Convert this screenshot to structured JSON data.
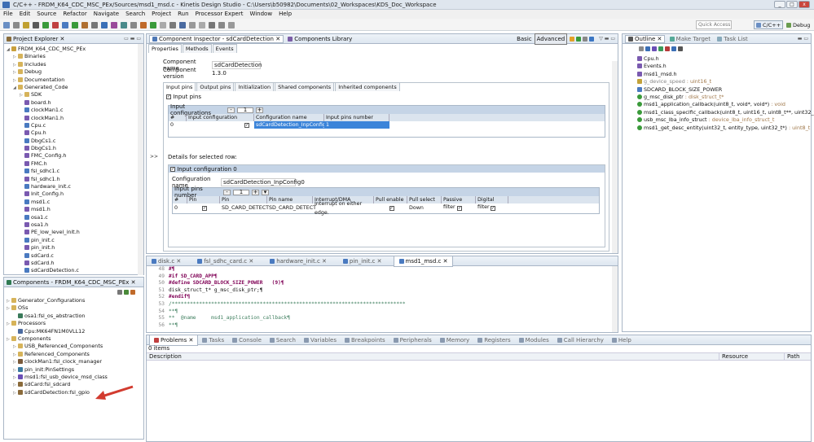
{
  "window": {
    "title": "C/C++ - FRDM_K64_CDC_MSC_PEx/Sources/msd1_msd.c - Kinetis Design Studio - C:\\Users\\b50982\\Documents\\02_Workspaces\\KDS_Doc_Workspace"
  },
  "menu": [
    "File",
    "Edit",
    "Source",
    "Refactor",
    "Navigate",
    "Search",
    "Project",
    "Run",
    "Processor Expert",
    "Window",
    "Help"
  ],
  "toolbar": {
    "quick_access": "Quick Access",
    "perspective_cpp": "C/C++",
    "perspective_debug": "Debug"
  },
  "project_explorer": {
    "tab": "Project Explorer",
    "items": [
      "FRDM_K64_CDC_MSC_PEx",
      "Binaries",
      "Includes",
      "Debug",
      "Documentation",
      "Generated_Code",
      "SDK",
      "board.h",
      "clockMan1.c",
      "clockMan1.h",
      "Cpu.c",
      "Cpu.h",
      "DbgCs1.c",
      "DbgCs1.h",
      "FMC_Config.h",
      "FMC.h",
      "fsl_sdhc1.c",
      "fsl_sdhc1.h",
      "hardware_init.c",
      "Init_Config.h",
      "msd1.c",
      "msd1.h",
      "osa1.c",
      "osa1.h",
      "PE_low_level_init.h",
      "pin_init.c",
      "pin_init.h",
      "sdCard.c",
      "sdCard.h",
      "sdCardDetection.c"
    ]
  },
  "components": {
    "tab": "Components - FRDM_K64_CDC_MSC_PEx",
    "items": [
      "Generator_Configurations",
      "OSs",
      "osa1:fsl_os_abstraction",
      "Processors",
      "Cpu:MK64FN1M0VLL12",
      "Components",
      "USB_Referenced_Components",
      "Referenced_Components",
      "clockMan1:fsl_clock_manager",
      "pin_init:PinSettings",
      "msd1:fsl_usb_device_msd_class",
      "sdCard:fsl_sdcard",
      "sdCardDetection:fsl_gpio"
    ]
  },
  "inspector": {
    "tab1": "Component Inspector - sdCardDetection",
    "tab2": "Components Library",
    "basic": "Basic",
    "advanced": "Advanced",
    "subtabs": [
      "Properties",
      "Methods",
      "Events"
    ],
    "component_name_label": "Component name",
    "component_name": "sdCardDetection",
    "component_version_label": "Component version",
    "component_version": "1.3.0",
    "pin_tabs": [
      "Input pins",
      "Output pins",
      "Initialization",
      "Shared components",
      "Inherited components"
    ],
    "input_pins_check": "Input pins",
    "input_configurations": "Input configurations",
    "count1": "1",
    "config_headers": [
      "#",
      "Input configuration",
      "Configuration name",
      "Input pins number"
    ],
    "config_row": [
      "0",
      "",
      "sdCardDetection_InpConfig0",
      "1"
    ],
    "details_label": "Details for selected row:",
    "input_config0": "Input configuration 0",
    "config_name_label": "Configuration name",
    "config_name": "sdCardDetection_InpConfig0",
    "input_pins_number": "Input pins number",
    "count2": "1",
    "pin_headers": [
      "#",
      "Pin",
      "Pin",
      "Pin name",
      "Interrupt/DMA",
      "Pull enable",
      "Pull select",
      "Passive filter",
      "Digital filter"
    ],
    "pin_row": [
      "0",
      "",
      "SD_CARD_DETECT",
      "SD_CARD_DETECT",
      "Interrupt on either edge.",
      "",
      "Down",
      "",
      ""
    ]
  },
  "outline": {
    "tab1": "Outline",
    "tab2": "Make Target",
    "tab3": "Task List",
    "items": [
      {
        "name": "Cpu.h",
        "type": ""
      },
      {
        "name": "Events.h",
        "type": ""
      },
      {
        "name": "msd1_msd.h",
        "type": ""
      },
      {
        "name": "g_device_speed",
        "type": " : uint16_t"
      },
      {
        "name": "SDCARD_BLOCK_SIZE_POWER",
        "type": ""
      },
      {
        "name": "g_msc_disk_ptr",
        "type": " : disk_struct_t*"
      },
      {
        "name": "msd1_application_callback(uint8_t, void*, void*)",
        "type": " : void"
      },
      {
        "name": "msd1_class_specific_callback(uint8_t, uint16_t, uint8_t**, uint32_t*, void*)",
        "type": ""
      },
      {
        "name": "usb_msc_lba_info_struct",
        "type": " : device_lba_info_struct_t"
      },
      {
        "name": "msd1_get_desc_entity(uint32_t, entity_type, uint32_t*)",
        "type": " : uint8_t"
      }
    ]
  },
  "editor": {
    "tabs": [
      "disk.c",
      "fsl_sdhc_card.c",
      "hardware_init.c",
      "pin_init.c",
      "msd1_msd.c"
    ],
    "lines": [
      {
        "n": "48",
        "t": "#¶"
      },
      {
        "n": "49",
        "t": "#if SD_CARD_APP¶"
      },
      {
        "n": "50",
        "t": "#define SDCARD_BLOCK_SIZE_POWER   (9)¶"
      },
      {
        "n": "51",
        "t": "disk_struct_t* g_msc_disk_ptr;¶"
      },
      {
        "n": "52",
        "t": "#endif¶"
      },
      {
        "n": "53",
        "t": "/*****************************************************************************"
      },
      {
        "n": "54",
        "t": "**¶"
      },
      {
        "n": "55",
        "t": "**  @name     msd1_application_callback¶"
      },
      {
        "n": "56",
        "t": "**¶"
      }
    ]
  },
  "problems": {
    "tabs": [
      "Problems",
      "Tasks",
      "Console",
      "Search",
      "Variables",
      "Breakpoints",
      "Peripherals",
      "Memory",
      "Registers",
      "Modules",
      "Call Hierarchy",
      "Help"
    ],
    "count": "0 items",
    "col_description": "Description",
    "col_resource": "Resource",
    "col_path": "Path"
  }
}
